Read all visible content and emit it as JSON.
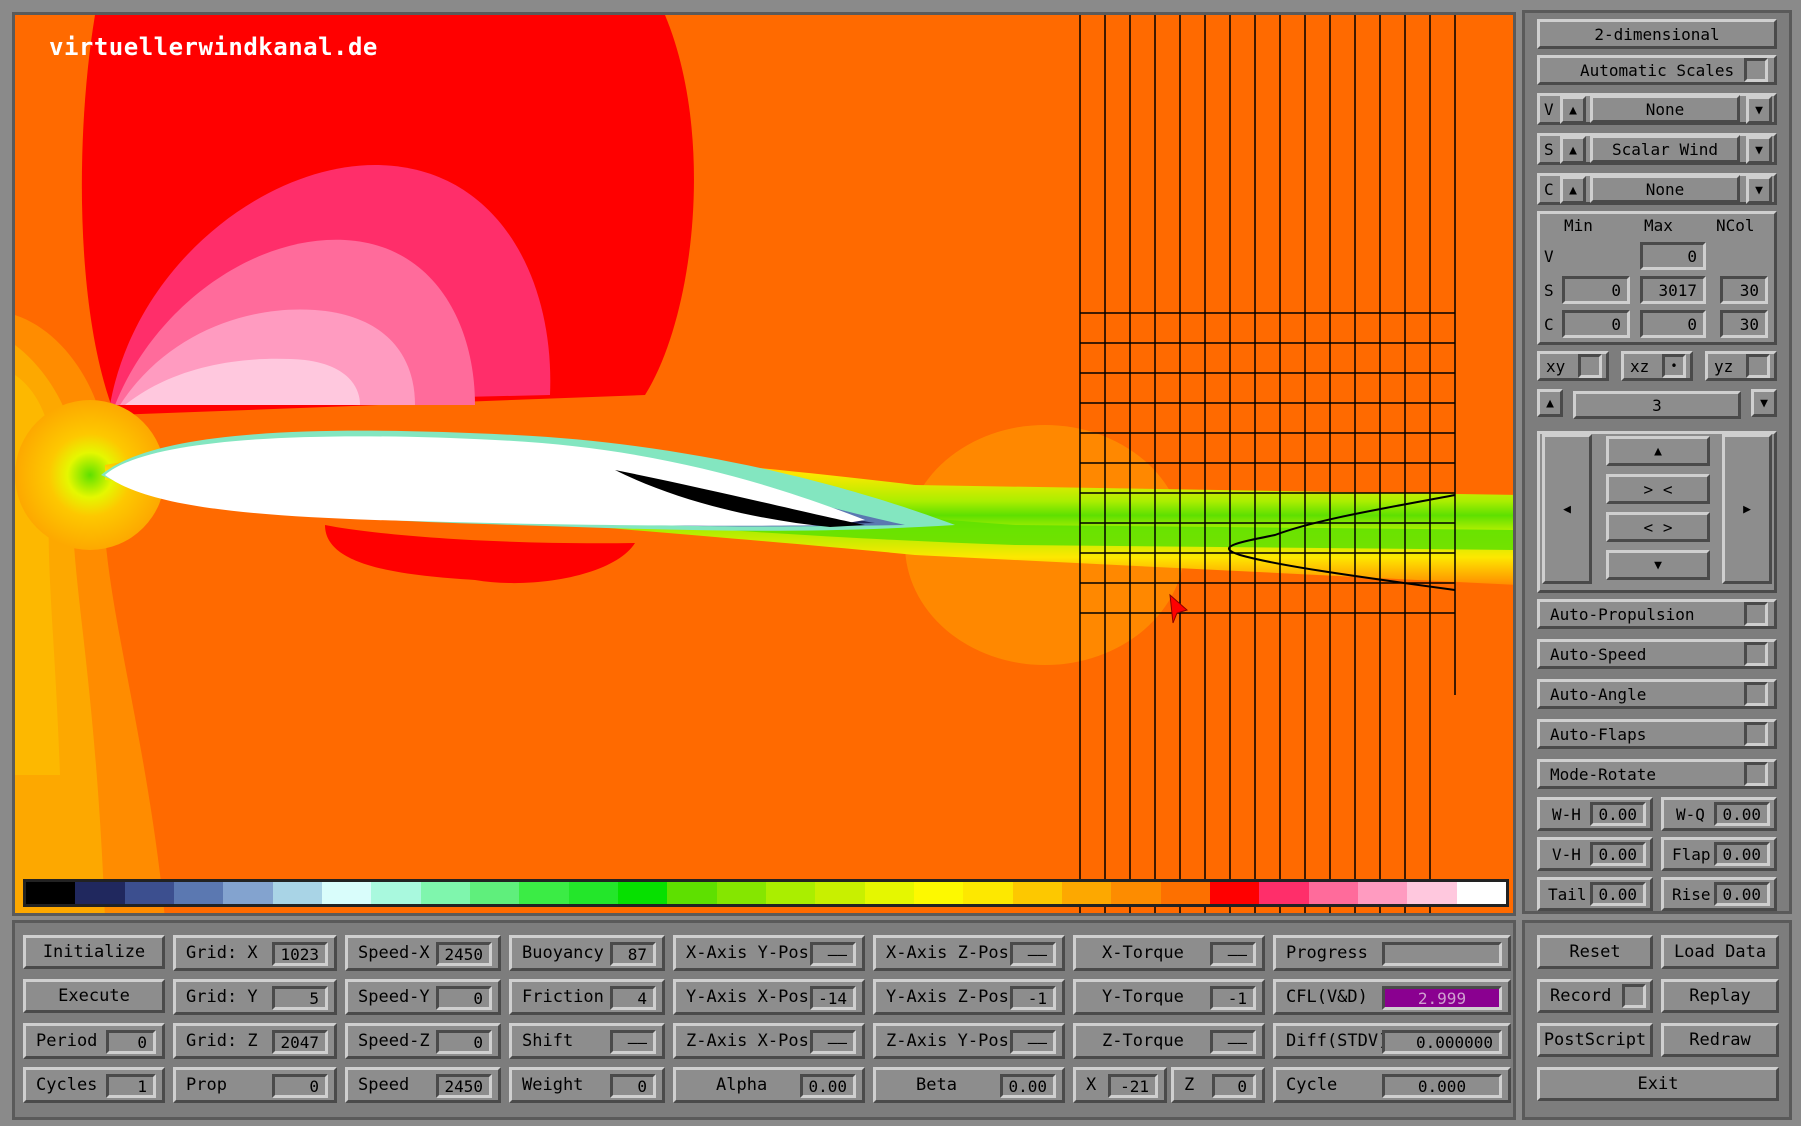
{
  "watermark": "virtuellerwindkanal.de",
  "colors": {
    "background_field": "#ff6a00",
    "panel": "#7d7d7d",
    "cfl_value_bg": "#8a0090"
  },
  "colorbar": [
    "#000000",
    "#20285e",
    "#3c4f8f",
    "#5b78b1",
    "#83a3cf",
    "#a9d4e6",
    "#d9fdfb",
    "#a9f9de",
    "#7ff6ad",
    "#5fef7c",
    "#3bec45",
    "#23e62a",
    "#06e000",
    "#5ee000",
    "#85e600",
    "#aaee00",
    "#c8f000",
    "#e5f700",
    "#fdf900",
    "#fde800",
    "#fdc800",
    "#fda800",
    "#fd8c00",
    "#fd7000",
    "#ff0000",
    "#ff2e6a",
    "#ff6b9b",
    "#ff9bc0",
    "#ffc8de",
    "#ffffff"
  ],
  "right": {
    "mode": "2-dimensional",
    "auto_scales": "Automatic Scales",
    "v_label": "V",
    "v_select": "None",
    "s_label": "S",
    "s_select": "Scalar Wind",
    "c_label": "C",
    "c_select": "None",
    "hdr_min": "Min",
    "hdr_max": "Max",
    "hdr_ncol": "NCol",
    "row_v": "V",
    "v_max": "0",
    "row_s": "S",
    "s_min": "0",
    "s_max": "3017",
    "s_ncol": "30",
    "row_c": "C",
    "c_min": "0",
    "c_max": "0",
    "c_ncol": "30",
    "plane_xy": "xy",
    "plane_xz": "xz",
    "plane_yz": "yz",
    "slice": "3",
    "arrow_up": "▲",
    "arrow_down": "▼",
    "arrow_left": "◀",
    "arrow_right": "▶",
    "zoom_in": "> <",
    "zoom_out": "< >",
    "auto_propulsion": "Auto-Propulsion",
    "auto_speed": "Auto-Speed",
    "auto_angle": "Auto-Angle",
    "auto_flaps": "Auto-Flaps",
    "mode_rotate": "Mode-Rotate",
    "wh_label": "W-H",
    "wh": "0.00",
    "wq_label": "W-Q",
    "wq": "0.00",
    "vh_label": "V-H",
    "vh": "0.00",
    "flap_label": "Flap",
    "flap": "0.00",
    "tail_label": "Tail",
    "tail": "0.00",
    "rise_label": "Rise",
    "rise": "0.00"
  },
  "bottom": {
    "initialize": "Initialize",
    "execute": "Execute",
    "period_label": "Period",
    "period": "0",
    "cycles_label": "Cycles",
    "cycles": "1",
    "gridx_label": "Grid: X",
    "gridx": "1023",
    "gridy_label": "Grid: Y",
    "gridy": "5",
    "gridz_label": "Grid: Z",
    "gridz": "2047",
    "prop_label": "Prop",
    "prop": "0",
    "speedx_label": "Speed-X",
    "speedx": "2450",
    "speedy_label": "Speed-Y",
    "speedy": "0",
    "speedz_label": "Speed-Z",
    "speedz": "0",
    "speed_label": "Speed",
    "speed": "2450",
    "buoyancy_label": "Buoyancy",
    "buoyancy": "87",
    "friction_label": "Friction",
    "friction": "4",
    "shift_label": "Shift",
    "shift": "——",
    "weight_label": "Weight",
    "weight": "0",
    "xaxis_ypos_label": "X-Axis Y-Pos",
    "xaxis_ypos": "——",
    "yaxis_xpos_label": "Y-Axis X-Pos",
    "yaxis_xpos": "-14",
    "zaxis_xpos_label": "Z-Axis X-Pos",
    "zaxis_xpos": "——",
    "alpha_label": "Alpha",
    "alpha": "0.00",
    "xaxis_zpos_label": "X-Axis Z-Pos",
    "xaxis_zpos": "——",
    "yaxis_zpos_label": "Y-Axis Z-Pos",
    "yaxis_zpos": "-1",
    "zaxis_ypos_label": "Z-Axis Y-Pos",
    "zaxis_ypos": "——",
    "beta_label": "Beta",
    "beta": "0.00",
    "xtorque_label": "X-Torque",
    "xtorque": "——",
    "ytorque_label": "Y-Torque",
    "ytorque": "-1",
    "ztorque_label": "Z-Torque",
    "ztorque": "——",
    "x_label": "X",
    "x": "-21",
    "z_label": "Z",
    "z": "0",
    "progress_label": "Progress",
    "cfl_label": "CFL(V&D)",
    "cfl": "2.999",
    "diff_label": "Diff(STDV)",
    "diff": "0.000000",
    "cycle_label": "Cycle",
    "cycle": "0.000",
    "reset": "Reset",
    "load_data": "Load Data",
    "record": "Record",
    "replay": "Replay",
    "postscript": "PostScript",
    "redraw": "Redraw",
    "exit": "Exit"
  }
}
